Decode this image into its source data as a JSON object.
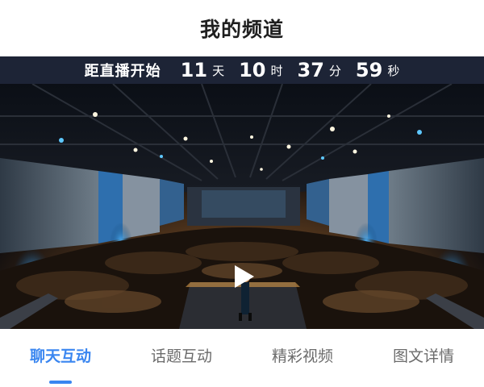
{
  "header": {
    "title": "我的频道"
  },
  "countdown": {
    "label": "距直播开始",
    "days": "11",
    "days_unit": "天",
    "hours": "10",
    "hours_unit": "时",
    "minutes": "37",
    "minutes_unit": "分",
    "seconds": "59",
    "seconds_unit": "秒"
  },
  "video": {
    "play_icon": "play-icon"
  },
  "tabs": [
    {
      "label": "聊天互动",
      "active": true
    },
    {
      "label": "话题互动",
      "active": false
    },
    {
      "label": "精彩视频",
      "active": false
    },
    {
      "label": "图文详情",
      "active": false
    }
  ],
  "colors": {
    "accent": "#3a86f0",
    "countdown_bg": "#1d2436",
    "title": "#1f1f1f",
    "tab_inactive": "#6b6b6b"
  }
}
